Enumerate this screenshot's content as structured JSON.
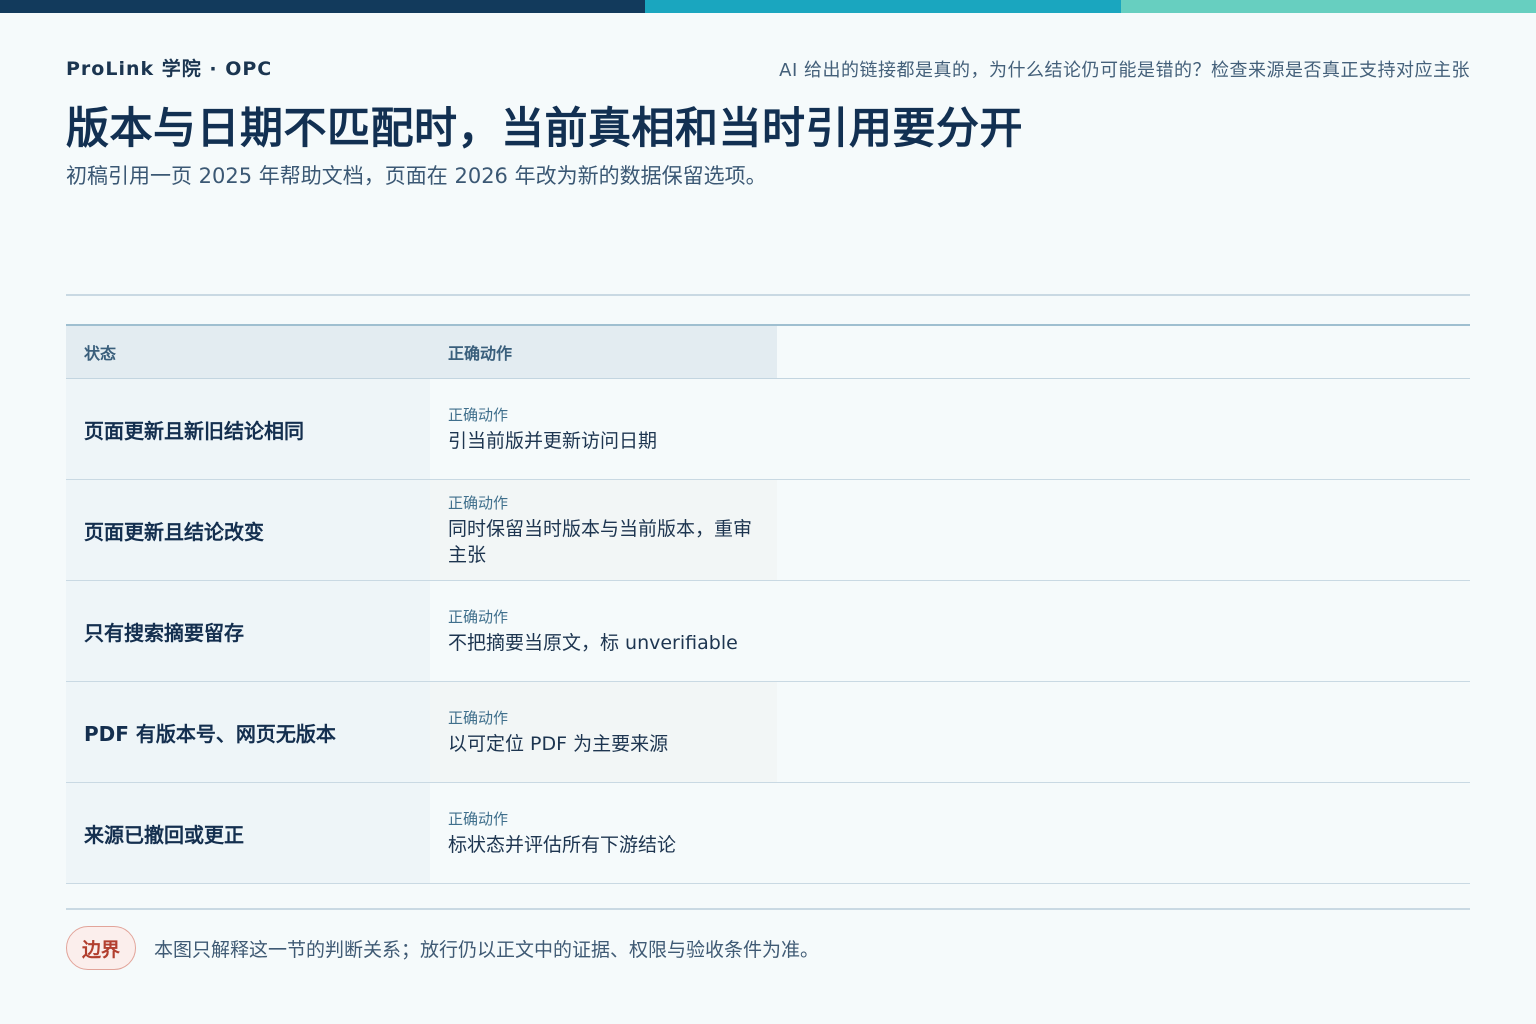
{
  "header": {
    "eyebrow": "ProLink 学院 · OPC",
    "question": "AI 给出的链接都是真的，为什么结论仍可能是错的？检查来源是否真正支持对应主张"
  },
  "title": "版本与日期不匹配时，当前真相和当时引用要分开",
  "subtitle": "初稿引用一页 2025 年帮助文档，页面在 2026 年改为新的数据保留选项。",
  "table": {
    "headers": {
      "state": "状态",
      "action": "正确动作"
    },
    "rows": [
      {
        "state": "页面更新且新旧结论相同",
        "action_label": "正确动作",
        "action": "引当前版并更新访问日期"
      },
      {
        "state": "页面更新且结论改变",
        "action_label": "正确动作",
        "action": "同时保留当时版本与当前版本，重审主张"
      },
      {
        "state": "只有搜索摘要留存",
        "action_label": "正确动作",
        "action": "不把摘要当原文，标 unverifiable"
      },
      {
        "state": "PDF 有版本号、网页无版本",
        "action_label": "正确动作",
        "action": "以可定位 PDF 为主要来源"
      },
      {
        "state": "来源已撤回或更正",
        "action_label": "正确动作",
        "action": "标状态并评估所有下游结论"
      }
    ]
  },
  "footer": {
    "badge": "边界",
    "note": "本图只解释这一节的判断关系；放行仍以正文中的证据、权限与验收条件为准。"
  },
  "colors": {
    "navy": "#123a5c",
    "teal": "#1aa6bf",
    "mint": "#67cfc0",
    "warning": "#b23f2f"
  }
}
